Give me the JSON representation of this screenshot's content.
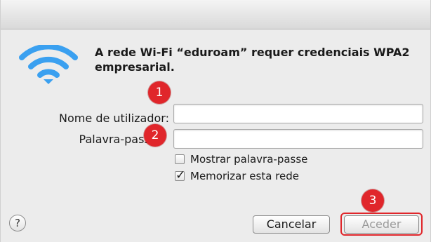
{
  "dialog": {
    "message": "A rede Wi-Fi “eduroam” requer credenciais WPA2 empresarial.",
    "wifi_icon": "wifi-icon"
  },
  "form": {
    "username_label": "Nome de utilizador:",
    "username_value": "",
    "password_label": "Palavra-passe:",
    "password_value": ""
  },
  "options": {
    "show_password_label": "Mostrar palavra-passe",
    "show_password_checked": false,
    "remember_label": "Memorizar esta rede",
    "remember_checked": true
  },
  "buttons": {
    "help_label": "?",
    "cancel_label": "Cancelar",
    "accept_label": "Aceder"
  },
  "annotations": {
    "step1": "1",
    "step2": "2",
    "step3": "3",
    "color": "#e0262b"
  }
}
